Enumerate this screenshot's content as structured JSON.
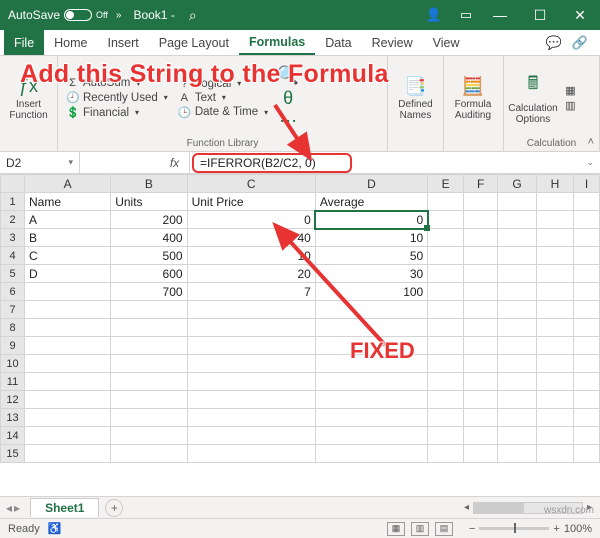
{
  "titlebar": {
    "autosave": "AutoSave",
    "autosave_state": "Off",
    "docname": "Book1 -",
    "search_icon": "⌕"
  },
  "tabs": {
    "file": "File",
    "home": "Home",
    "insert": "Insert",
    "pagelayout": "Page Layout",
    "formulas": "Formulas",
    "data": "Data",
    "review": "Review",
    "view": "View"
  },
  "ribbon": {
    "insert_function": "Insert\nFunction",
    "autosum": "AutoSum",
    "recent": "Recently Used",
    "financial": "Financial",
    "logical": "Logical",
    "text": "Text",
    "datetime": "Date & Time",
    "group_lib": "Function Library",
    "defined_names": "Defined\nNames",
    "formula_auditing": "Formula\nAuditing",
    "calc_options": "Calculation\nOptions",
    "group_calc": "Calculation"
  },
  "overlay": {
    "title": "Add this String to the Formula",
    "fixed": "FIXED"
  },
  "fx": {
    "cellref": "D2",
    "fx": "fx",
    "formula": "=IFERROR(B2/C2, 0)"
  },
  "cols": [
    "A",
    "B",
    "C",
    "D",
    "E",
    "F",
    "G",
    "H",
    "I"
  ],
  "headers": {
    "a": "Name",
    "b": "Units",
    "c": "Unit Price",
    "d": "Average"
  },
  "rows": [
    {
      "a": "A",
      "b": "200",
      "c": "0",
      "d": "0"
    },
    {
      "a": "B",
      "b": "400",
      "c": "40",
      "d": "10"
    },
    {
      "a": "C",
      "b": "500",
      "c": "10",
      "d": "50"
    },
    {
      "a": "D",
      "b": "600",
      "c": "20",
      "d": "30"
    },
    {
      "a": "",
      "b": "700",
      "c": "7",
      "d": "100"
    }
  ],
  "sheets": {
    "sheet1": "Sheet1"
  },
  "status": {
    "ready": "Ready",
    "zoom": "100%"
  },
  "watermark": "wsxdn.com"
}
